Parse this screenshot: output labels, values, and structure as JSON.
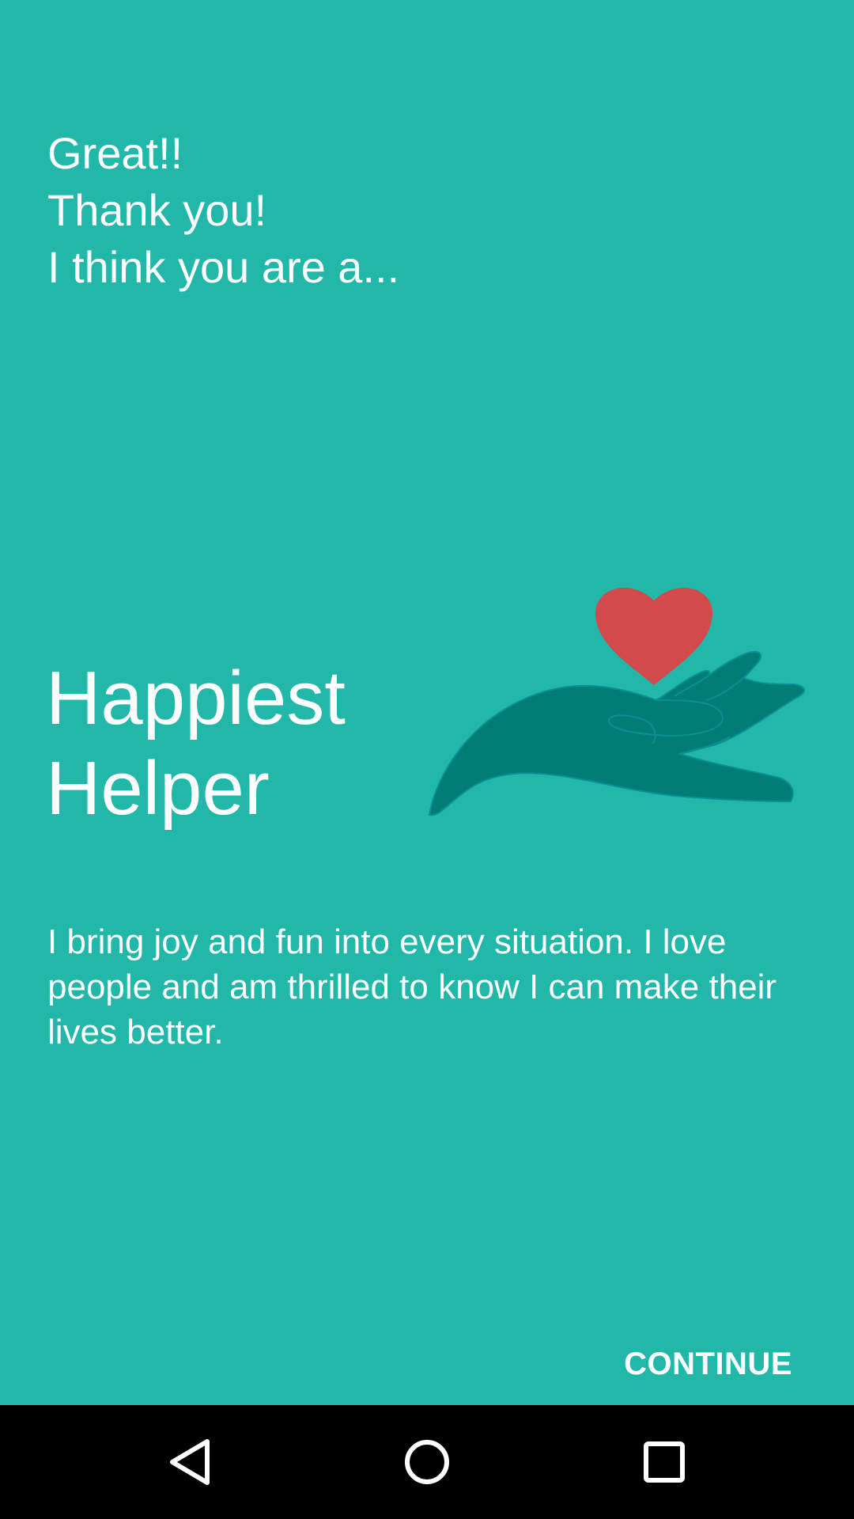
{
  "intro": {
    "line1": "Great!!",
    "line2": "Thank you!",
    "line3": "I think you are a..."
  },
  "result": {
    "title_line1": "Happiest",
    "title_line2": "Helper",
    "description": "I bring joy and fun into every situation. I love people and am thrilled to know I can make their lives better.",
    "illustration": "hand-holding-heart-icon"
  },
  "actions": {
    "continue_label": "CONTINUE"
  },
  "navigation": {
    "back": "back-icon",
    "home": "home-icon",
    "recents": "recents-icon"
  },
  "colors": {
    "background": "#21b8aa",
    "hand": "#017d75",
    "heart": "#d14b4c",
    "text": "#ffffff",
    "nav_bar": "#000000"
  }
}
